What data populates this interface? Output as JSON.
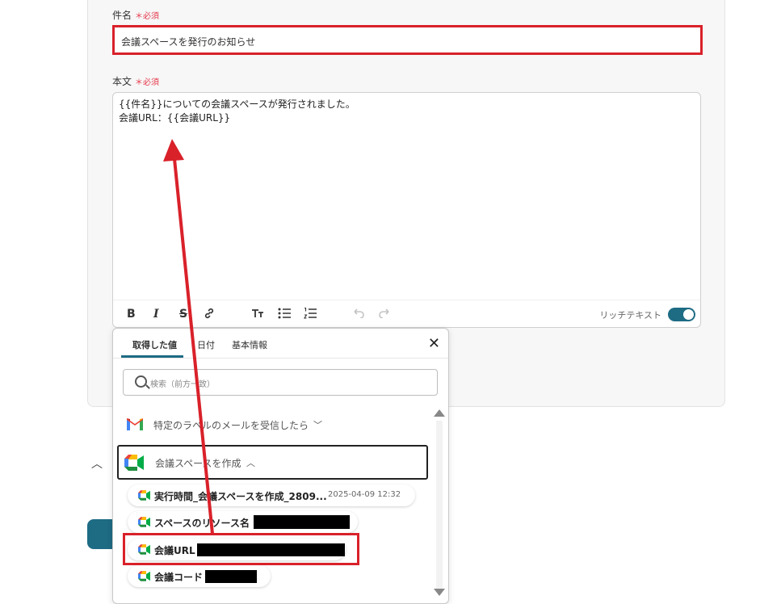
{
  "form": {
    "subject_label": "件名",
    "subject_required": "必須",
    "subject_value": "会議スペースを発行のお知らせ",
    "body_label": "本文",
    "body_required": "必須",
    "body_value": "{{件名}}についての会議スペースが発行されました。\n会議URL：{{会議URL}}",
    "rich_text_label": "リッチテキスト",
    "rich_text_enabled": true,
    "toolbar": {
      "bold_icon": "B",
      "italic_icon": "I",
      "strike_icon": "S",
      "link_icon": "link-icon",
      "heading_icon": "heading-icon",
      "bullet_list_icon": "bullet-list-icon",
      "ordered_list_icon": "ordered-list-icon",
      "undo_icon": "undo-icon",
      "redo_icon": "redo-icon"
    }
  },
  "popup": {
    "tabs": [
      {
        "label": "取得した値",
        "active": true
      },
      {
        "label": "日付",
        "active": false
      },
      {
        "label": "基本情報",
        "active": false
      }
    ],
    "search_placeholder": "検索（前方一致）",
    "groups": [
      {
        "label": "特定のラベルのメールを受信したら",
        "icon": "gmail-icon",
        "expanded": false
      },
      {
        "label": "会議スペースを作成",
        "icon": "google-meet-icon",
        "expanded": true
      }
    ],
    "items": [
      {
        "label": "実行時間_会議スペースを作成_2809...",
        "value": "2025-04-09 12:32",
        "icon": "google-meet-icon"
      },
      {
        "label": "スペースのリソース名",
        "value": "",
        "icon": "google-meet-icon"
      },
      {
        "label": "会議URL",
        "value": "",
        "icon": "google-meet-icon"
      },
      {
        "label": "会議コード",
        "value": "",
        "icon": "google-meet-icon"
      }
    ]
  },
  "colors": {
    "accent": "#1e6b84",
    "highlight_red": "#d9212a",
    "required_red": "#e5374a"
  }
}
